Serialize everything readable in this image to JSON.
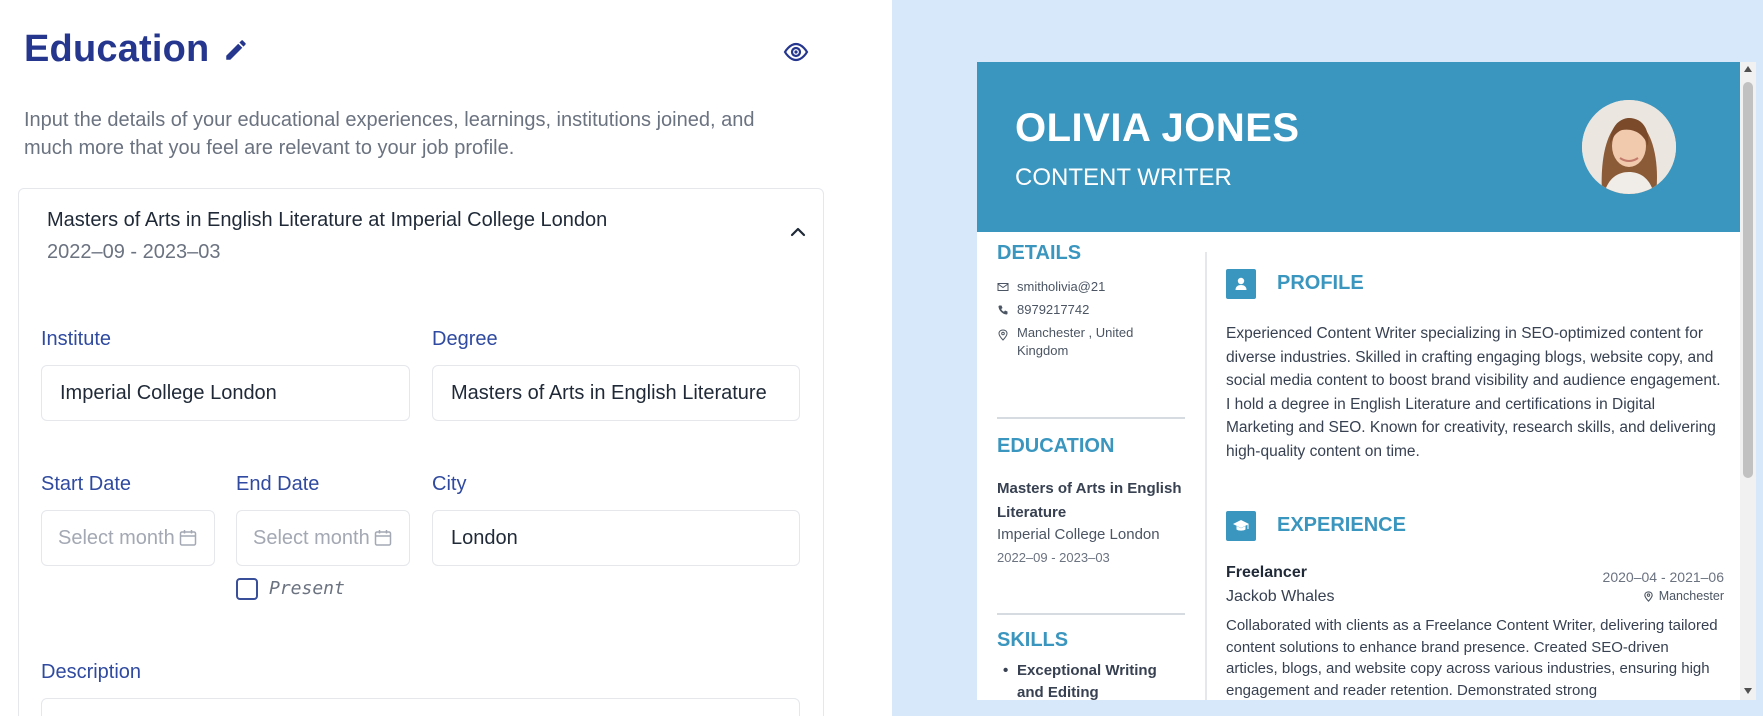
{
  "editor": {
    "title": "Education",
    "intro": "Input the details of your educational experiences, learnings, institutions joined, and much more that you feel are relevant to your job profile.",
    "entry": {
      "heading": "Masters of Arts in English Literature at Imperial College London",
      "dates": "2022–09 - 2023–03"
    },
    "fields": {
      "institute_label": "Institute",
      "institute_value": "Imperial College London",
      "degree_label": "Degree",
      "degree_value": "Masters of Arts in English Literature",
      "start_label": "Start Date",
      "start_placeholder": "Select month",
      "end_label": "End Date",
      "end_placeholder": "Select month",
      "city_label": "City",
      "city_value": "London",
      "present_label": "Present",
      "description_label": "Description"
    }
  },
  "resume": {
    "name": "OLIVIA JONES",
    "role": "CONTENT WRITER",
    "accent": "#3a96bf",
    "details": {
      "title": "DETAILS",
      "email": "smitholivia@21",
      "phone": "8979217742",
      "location": "Manchester , United Kingdom"
    },
    "education": {
      "title": "EDUCATION",
      "degree": "Masters of Arts in English Literature",
      "institute": "Imperial College London",
      "dates": "2022–09 - 2023–03"
    },
    "skills": {
      "title": "SKILLS",
      "items": [
        "Exceptional Writing and Editing"
      ]
    },
    "profile": {
      "title": "PROFILE",
      "text": "Experienced Content Writer specializing in SEO-optimized content for diverse industries. Skilled in crafting engaging blogs, website copy, and social media content to boost brand visibility and audience engagement. I hold a degree in English Literature and certifications in Digital Marketing and SEO. Known for creativity, research skills, and delivering high-quality content on time."
    },
    "experience": {
      "title": "EXPERIENCE",
      "job_title": "Freelancer",
      "company": "Jackob Whales",
      "dates": "2020–04 - 2021–06",
      "location": "Manchester",
      "description": "Collaborated with clients as a Freelance Content Writer, delivering tailored content solutions to enhance brand presence. Created SEO-driven articles, blogs, and website copy across various industries, ensuring high engagement and reader retention. Demonstrated strong"
    }
  }
}
